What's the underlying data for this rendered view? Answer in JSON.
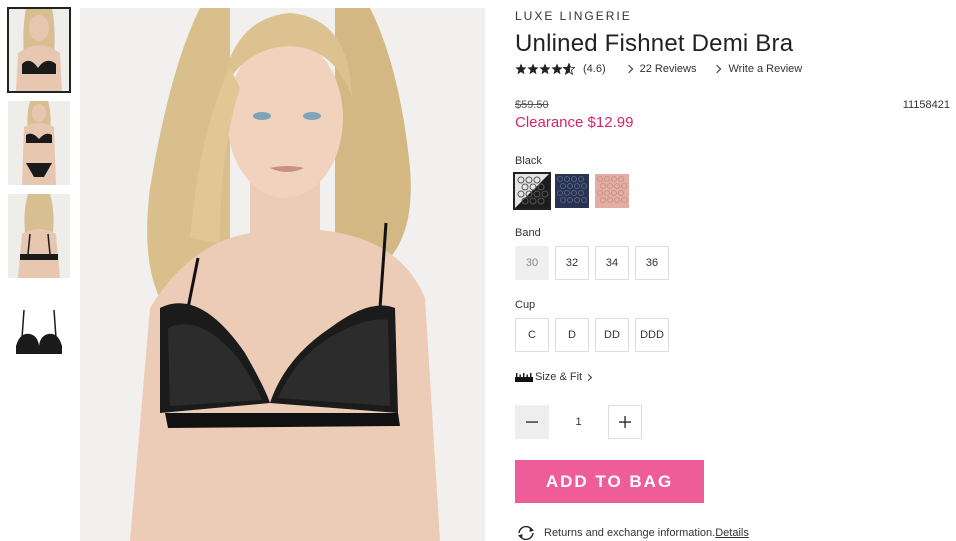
{
  "product": {
    "brand": "LUXE LINGERIE",
    "title": "Unlined Fishnet Demi Bra",
    "rating": "(4.6)",
    "reviews_link": "22 Reviews",
    "write_review_link": "Write a Review",
    "old_price": "$59.50",
    "sale_price": "Clearance $12.99",
    "item_number": "11158421"
  },
  "color": {
    "label": "Black",
    "swatches": [
      {
        "name": "Black",
        "hex": "#1c1c1c",
        "selected": true
      },
      {
        "name": "Navy",
        "hex": "#2b3352",
        "selected": false
      },
      {
        "name": "Pink",
        "hex": "#e2aea3",
        "selected": false
      }
    ]
  },
  "band": {
    "label": "Band",
    "options": [
      {
        "value": "30",
        "available": false
      },
      {
        "value": "32",
        "available": true
      },
      {
        "value": "34",
        "available": true
      },
      {
        "value": "36",
        "available": true
      }
    ]
  },
  "cup": {
    "label": "Cup",
    "options": [
      {
        "value": "C",
        "available": true
      },
      {
        "value": "D",
        "available": true
      },
      {
        "value": "DD",
        "available": true
      },
      {
        "value": "DDD",
        "available": true
      }
    ]
  },
  "size_fit_link": "Size & Fit",
  "quantity": "1",
  "add_to_bag": "ADD TO BAG",
  "returns": {
    "text": "Returns and exchange information.",
    "link": "Details"
  },
  "colors": {
    "sale": "#d6246e",
    "add_button": "#ee5d9a"
  },
  "icons": {
    "stars": "star-icons",
    "ruler": "ruler-icon",
    "returns": "returns-arrows-icon"
  }
}
